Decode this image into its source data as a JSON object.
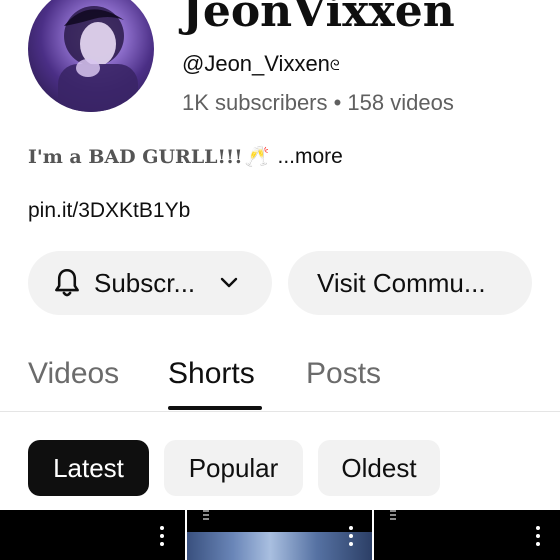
{
  "channel": {
    "name": "JeonVixxen",
    "handle": "@Jeon_Vixxen",
    "handle_glyph": "ᘓ",
    "stats": "1K subscribers • 158 videos",
    "avatar_icon": "profile-photo"
  },
  "bio": {
    "text": "I'm a BAD GURLL!!!",
    "emoji": "🥂",
    "more_label": "...more"
  },
  "link": "pin.it/3DXKtB1Yb",
  "actions": {
    "subscribe_label": "Subscr...",
    "subscribe_icon": "bell-icon",
    "subscribe_dropdown_icon": "chevron-down-icon",
    "community_label": "Visit Commu..."
  },
  "tabs": [
    {
      "label": "Videos",
      "active": false
    },
    {
      "label": "Shorts",
      "active": true
    },
    {
      "label": "Posts",
      "active": false
    }
  ],
  "filters": [
    {
      "label": "Latest",
      "selected": true
    },
    {
      "label": "Popular",
      "selected": false
    },
    {
      "label": "Oldest",
      "selected": false
    }
  ],
  "shorts_grid": {
    "item_count": 3,
    "menu_icon": "more-vertical-icon"
  },
  "colors": {
    "selected_chip_bg": "#0f0f0f",
    "pill_bg": "#f2f2f2",
    "secondary_text": "#606060"
  }
}
